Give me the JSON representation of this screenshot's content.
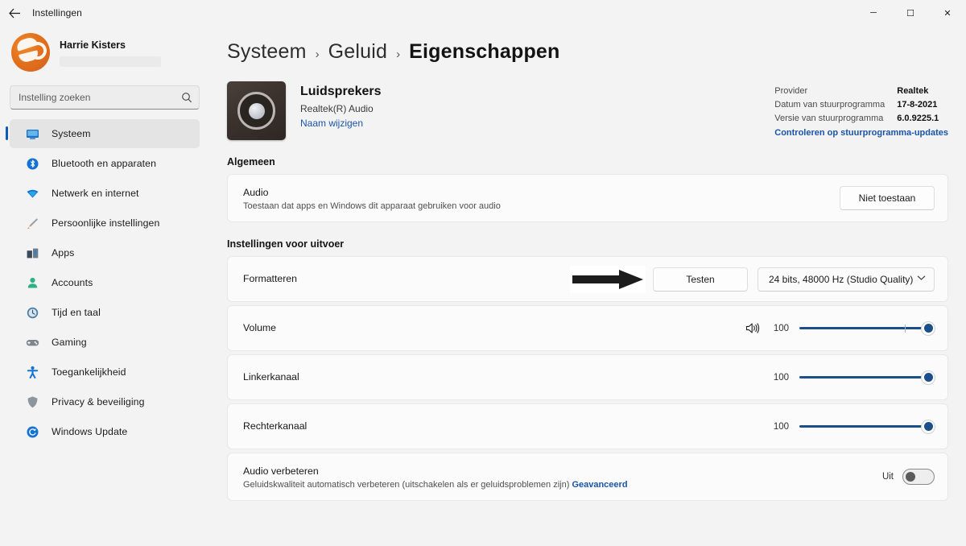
{
  "window": {
    "title": "Instellingen",
    "back_icon": "arrow-left-icon",
    "minimize_label": "─",
    "maximize_label": "☐",
    "close_label": "✕"
  },
  "sidebar": {
    "profile": {
      "name": "Harrie Kisters",
      "email_redacted": ""
    },
    "search": {
      "placeholder": "Instelling zoeken",
      "value": "",
      "icon": "search-icon"
    },
    "items": [
      {
        "label": "Systeem",
        "icon": "monitor-icon",
        "active": true
      },
      {
        "label": "Bluetooth en apparaten",
        "icon": "bluetooth-icon",
        "active": false
      },
      {
        "label": "Netwerk en internet",
        "icon": "network-icon",
        "active": false
      },
      {
        "label": "Persoonlijke instellingen",
        "icon": "paintbrush-icon",
        "active": false
      },
      {
        "label": "Apps",
        "icon": "apps-icon",
        "active": false
      },
      {
        "label": "Accounts",
        "icon": "person-icon",
        "active": false
      },
      {
        "label": "Tijd en taal",
        "icon": "clock-icon",
        "active": false
      },
      {
        "label": "Gaming",
        "icon": "gamepad-icon",
        "active": false
      },
      {
        "label": "Toegankelijkheid",
        "icon": "accessibility-icon",
        "active": false
      },
      {
        "label": "Privacy & beveiliging",
        "icon": "shield-icon",
        "active": false
      },
      {
        "label": "Windows Update",
        "icon": "update-icon",
        "active": false
      }
    ]
  },
  "breadcrumb": {
    "segments": [
      "Systeem",
      "Geluid",
      "Eigenschappen"
    ],
    "separator": "›"
  },
  "device": {
    "icon": "speaker-icon",
    "name": "Luidsprekers",
    "subtitle": "Realtek(R) Audio",
    "rename_link": "Naam wijzigen"
  },
  "driver": {
    "rows": [
      {
        "label": "Provider",
        "value": "Realtek"
      },
      {
        "label": "Datum van stuurprogramma",
        "value": "17-8-2021"
      },
      {
        "label": "Versie van stuurprogramma",
        "value": "6.0.9225.1"
      }
    ],
    "update_link": "Controleren op stuurprogramma-updates"
  },
  "sections": [
    {
      "title": "Algemeen",
      "cards": [
        {
          "name": "audio-card",
          "title": "Audio",
          "subtitle": "Toestaan dat apps en Windows dit apparaat gebruiken voor audio",
          "button": "Niet toestaan"
        }
      ]
    },
    {
      "title": "Instellingen voor uitvoer",
      "cards": [
        {
          "name": "format-card",
          "title": "Formatteren",
          "test_button": "Testen",
          "format_value": "24 bits, 48000 Hz (Studio Quality)",
          "chevron": "chevron-down-icon",
          "annotation": "arrow-right-annotation"
        },
        {
          "name": "volume-card",
          "title": "Volume",
          "icon": "speaker-wave-icon",
          "value": "100"
        },
        {
          "name": "left-channel-card",
          "title": "Linkerkanaal",
          "value": "100"
        },
        {
          "name": "right-channel-card",
          "title": "Rechterkanaal",
          "value": "100"
        },
        {
          "name": "enhance-audio-card",
          "title": "Audio verbeteren",
          "subtitle": "Geluidskwaliteit automatisch verbeteren (uitschakelen als er geluidsproblemen zijn)",
          "advanced_link": "Geavanceerd",
          "toggle_state": "Uit"
        }
      ]
    }
  ],
  "colors": {
    "accent": "#0a5bbf",
    "slider": "#1a4f89",
    "link": "#1a54a8",
    "page_bg": "#f3f3f3",
    "card_bg": "#fbfbfb"
  }
}
